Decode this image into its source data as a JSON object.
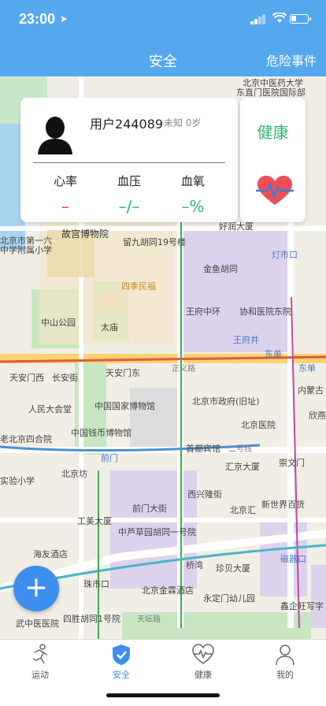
{
  "status": {
    "time": "23:00"
  },
  "nav": {
    "title": "安全",
    "right_action": "危险事件"
  },
  "card": {
    "username": "用户244089",
    "meta": "未知 0岁",
    "metrics": [
      {
        "label": "心率",
        "value": "–",
        "color": "#e0453e"
      },
      {
        "label": "血压",
        "value": "–/–",
        "color": "#35b56e"
      },
      {
        "label": "血氧",
        "value": "–%",
        "color": "#35b56e"
      }
    ],
    "state": "健康",
    "state_color": "#35b56e"
  },
  "map_labels": [
    "北京中医药大学",
    "东直门医院国际部",
    "故宫博物院",
    "留九胡同19号楼",
    "灯市口",
    "好润大厦",
    "金鱼胡同",
    "王府中环",
    "协和医院东院",
    "王府井",
    "四季民福",
    "中山公园",
    "太庙",
    "天安门西",
    "长安街",
    "天安门东",
    "东单",
    "东单",
    "内蒙古",
    "欣燕",
    "人民大会堂",
    "中国国家博物馆",
    "北京市政府(旧址)",
    "北京医院",
    "中国钱币博物馆",
    "首都宾馆",
    "二号线",
    "崇文门",
    "北京坊",
    "前门",
    "汇京大厦",
    "西兴隆街",
    "前门大街",
    "北京汇",
    "新世界百货",
    "工美大厦",
    "中芦草园胡同一号院",
    "桥湾",
    "珍贝大厦",
    "磁器口",
    "珠市口",
    "北京金霖酒店",
    "永定门幼儿园",
    "鑫企旺写字",
    "四胜胡同1号院",
    "天坛路",
    "武中医医院",
    "实验小学",
    "海友酒店",
    "北京市第一六",
    "中学附属小学",
    "正义路",
    "老北京四合院"
  ],
  "fab_label": "+",
  "tabs": [
    {
      "label": "运动",
      "icon": "running-person-icon",
      "active": false
    },
    {
      "label": "安全",
      "icon": "shield-check-icon",
      "active": true
    },
    {
      "label": "健康",
      "icon": "heart-pulse-icon",
      "active": false
    },
    {
      "label": "我的",
      "icon": "user-icon",
      "active": false
    }
  ],
  "colors": {
    "primary": "#55a8ee",
    "tab_active": "#3e8ef0",
    "healthy": "#35b56e",
    "alert": "#e0453e"
  }
}
